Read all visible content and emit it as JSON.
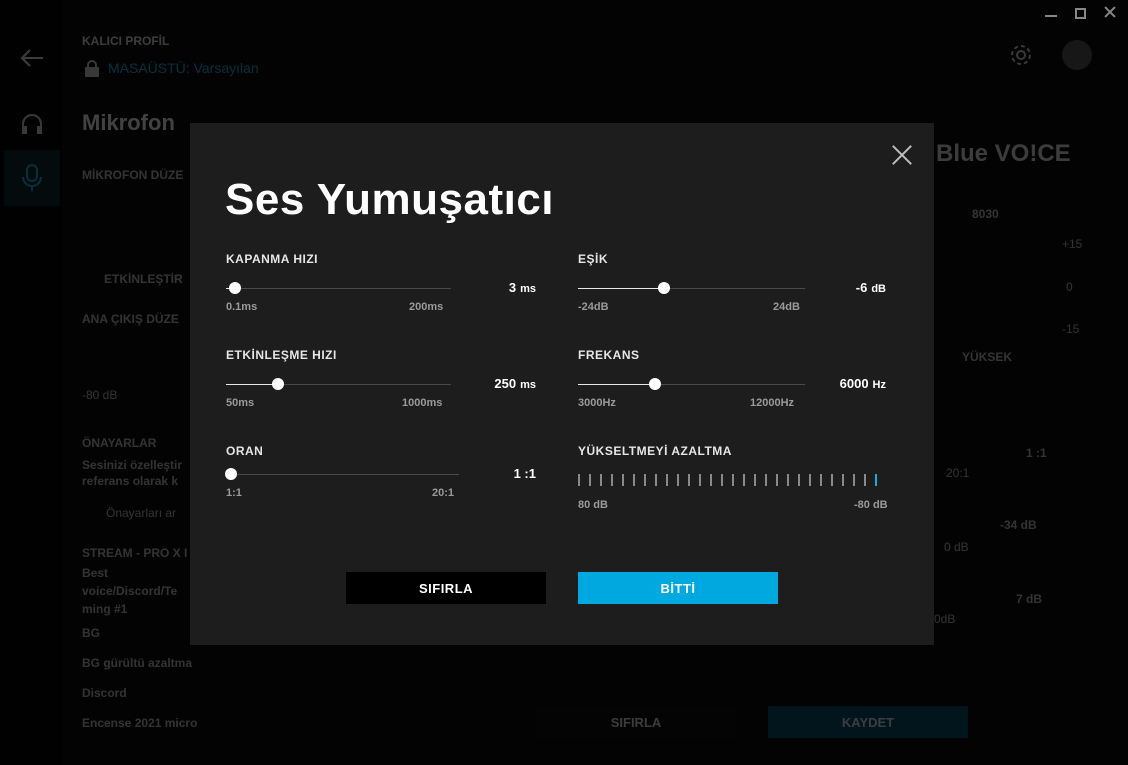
{
  "background": {
    "profile_label": "KALICI PROFİL",
    "profile_name": "MASAÜSTÜ: Varsayılan",
    "page_title": "Mikrofon",
    "mic_section": "MİKROFON DÜZE",
    "activate": "ETKİNLEŞTİR",
    "main_output": "ANA ÇIKIŞ DÜZE",
    "db80": "-80 dB",
    "presets_title": "ÖNAYARLAR",
    "presets_desc1": "Sesinizi özelleştir",
    "presets_desc2": "referans olarak k",
    "search_placeholder": "Önayarları ar",
    "preset_items": [
      "STREAM - PRO X I",
      "Best",
      "voice/Discord/Te",
      "ming #1",
      "BG",
      "BG gürültü azaltma",
      "Discord",
      "Encense 2021 micro"
    ],
    "brand_logo": "Blue VO!CE",
    "right_values": [
      "8030",
      "+15",
      "0",
      "-15",
      "YÜKSEK",
      "1 :1",
      "20:1",
      "-34 dB",
      "0 dB",
      "7 dB",
      "0dB"
    ],
    "reset_label": "SIFIRLA",
    "save_label": "KAYDET"
  },
  "modal": {
    "title": "Ses Yumuşatıcı",
    "reset_button": "SIFIRLA",
    "done_button": "BİTTİ",
    "sliders": {
      "release": {
        "label": "KAPANMA HIZI",
        "value": "3",
        "unit": "ms",
        "min": "0.1ms",
        "max": "200ms",
        "fraction": 0.04
      },
      "attack": {
        "label": "ETKİNLEŞME HIZI",
        "value": "250",
        "unit": "ms",
        "min": "50ms",
        "max": "1000ms",
        "fraction": 0.23
      },
      "ratio": {
        "label": "ORAN",
        "value": "1 :1",
        "unit": "",
        "min": "1:1",
        "max": "20:1",
        "fraction": 0.02
      },
      "threshold": {
        "label": "EŞİK",
        "value": "-6",
        "unit": "dB",
        "min": "-24dB",
        "max": "24dB",
        "fraction": 0.38
      },
      "frequency": {
        "label": "FREKANS",
        "value": "6000",
        "unit": "Hz",
        "min": "3000Hz",
        "max": "12000Hz",
        "fraction": 0.34
      }
    },
    "gain_reduction": {
      "label": "YÜKSELTMEYİ AZALTMA",
      "min": "80 dB",
      "max": "-80 dB",
      "tick_count": 28,
      "active_tick": 27
    }
  },
  "colors": {
    "accent": "#00a8e0",
    "modal_bg": "#1d1d1d"
  }
}
